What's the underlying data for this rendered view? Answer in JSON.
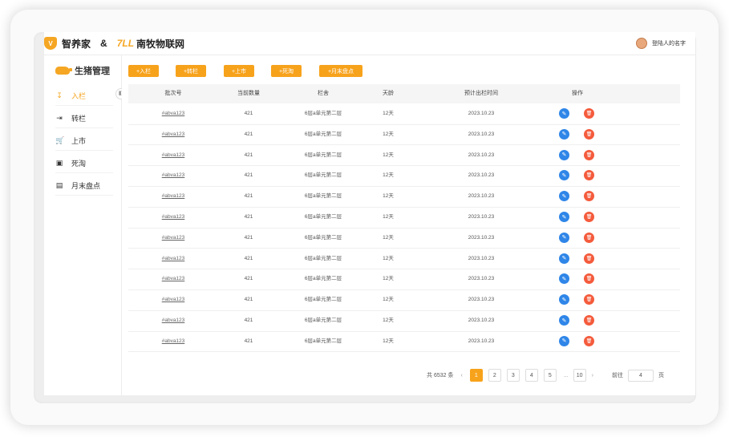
{
  "header": {
    "brand1": "智养家",
    "amp": "&",
    "brand2_logo": "7LL",
    "brand2": "南牧物联网",
    "user_name": "登陆人的名字"
  },
  "sidebar": {
    "title": "生猪管理",
    "items": [
      {
        "label": "入栏",
        "icon": "import-icon",
        "active": true
      },
      {
        "label": "转栏",
        "icon": "transfer-icon",
        "active": false
      },
      {
        "label": "上市",
        "icon": "cart-icon",
        "active": false
      },
      {
        "label": "死淘",
        "icon": "cull-icon",
        "active": false
      },
      {
        "label": "月末盘点",
        "icon": "inventory-icon",
        "active": false
      }
    ]
  },
  "toolbar": {
    "buttons": [
      "+入栏",
      "+转栏",
      "+上市",
      "+死淘",
      "+月末盘点"
    ]
  },
  "table": {
    "columns": [
      "批次号",
      "当前数量",
      "栏舍",
      "天龄",
      "预计出栏时间",
      "操作"
    ],
    "rows": [
      [
        "#abva123",
        "421",
        "6层a单元第二层",
        "12天",
        "2023.10.23"
      ],
      [
        "#abva123",
        "421",
        "6层a单元第二层",
        "12天",
        "2023.10.23"
      ],
      [
        "#abva123",
        "421",
        "6层a单元第二层",
        "12天",
        "2023.10.23"
      ],
      [
        "#abva123",
        "421",
        "6层a单元第二层",
        "12天",
        "2023.10.23"
      ],
      [
        "#abva123",
        "421",
        "6层a单元第二层",
        "12天",
        "2023.10.23"
      ],
      [
        "#abva123",
        "421",
        "6层a单元第二层",
        "12天",
        "2023.10.23"
      ],
      [
        "#abva123",
        "421",
        "6层a单元第二层",
        "12天",
        "2023.10.23"
      ],
      [
        "#abva123",
        "421",
        "6层a单元第二层",
        "12天",
        "2023.10.23"
      ],
      [
        "#abva123",
        "421",
        "6层a单元第二层",
        "12天",
        "2023.10.23"
      ],
      [
        "#abva123",
        "421",
        "6层a单元第二层",
        "12天",
        "2023.10.23"
      ],
      [
        "#abva123",
        "421",
        "6层a单元第二层",
        "12天",
        "2023.10.23"
      ],
      [
        "#abva123",
        "421",
        "6层a单元第二层",
        "12天",
        "2023.10.23"
      ]
    ]
  },
  "pagination": {
    "total": "共 6532 条",
    "prev": "‹",
    "pages": [
      "1",
      "2",
      "3",
      "4",
      "5"
    ],
    "ellipsis": "...",
    "last": "10",
    "next": "›",
    "goto_label": "前往",
    "goto_value": "4",
    "goto_suffix": "页"
  },
  "colors": {
    "accent": "#f7a21b",
    "edit": "#2f86e8",
    "delete": "#f45b3c"
  }
}
